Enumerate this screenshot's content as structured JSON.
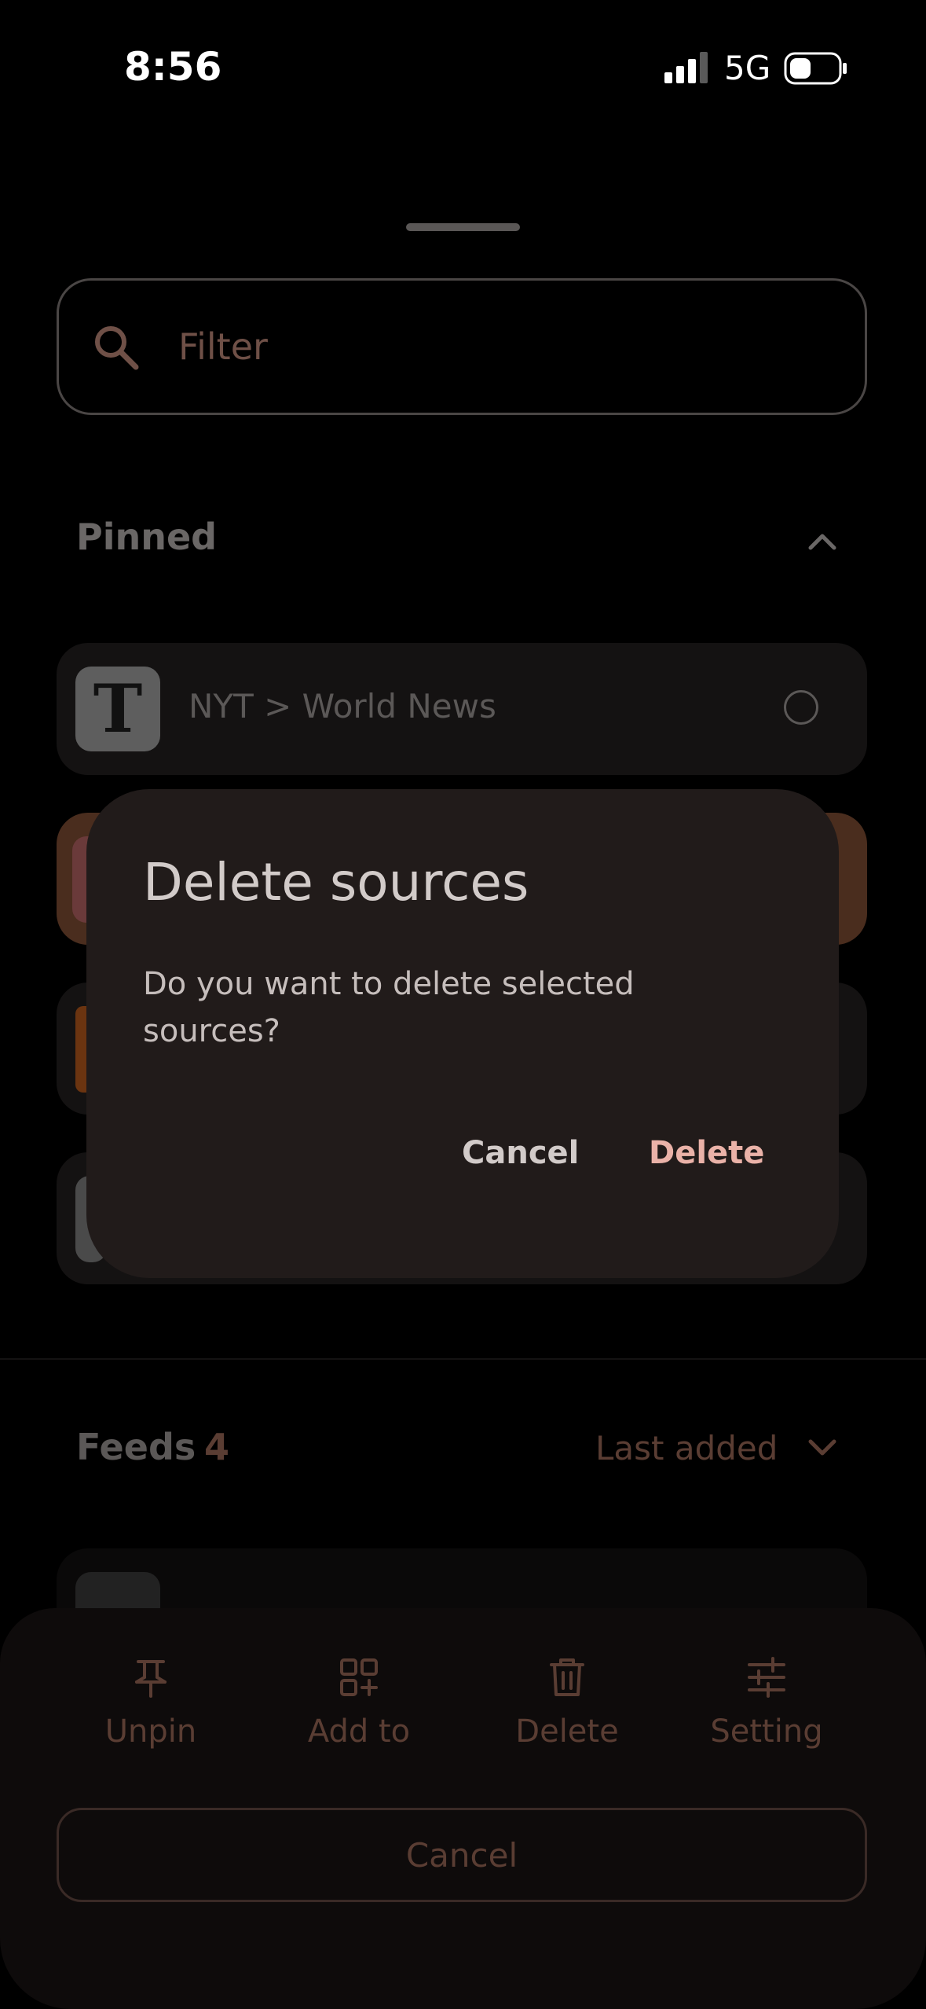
{
  "status_bar": {
    "time": "8:56",
    "network": "5G",
    "signal_icon": "cellular-signal-icon",
    "battery_icon": "battery-icon"
  },
  "filter": {
    "placeholder": "Filter",
    "icon": "search-icon"
  },
  "pinned": {
    "title": "Pinned",
    "items": [
      {
        "label": "NYT > World News",
        "logo": "T"
      }
    ]
  },
  "feeds": {
    "title": "Feeds",
    "count": "4",
    "sort_label": "Last added"
  },
  "dialog": {
    "title": "Delete sources",
    "message": "Do you want to delete selected sources?",
    "cancel_label": "Cancel",
    "delete_label": "Delete"
  },
  "bottom_actions": [
    {
      "label": "Unpin",
      "icon": "pin-icon"
    },
    {
      "label": "Add to",
      "icon": "add-to-group-icon"
    },
    {
      "label": "Delete",
      "icon": "trash-icon"
    },
    {
      "label": "Setting",
      "icon": "sliders-icon"
    }
  ],
  "bottom_cancel_label": "Cancel",
  "colors": {
    "dialog_bg": "#211b1a",
    "delete_accent": "#eab2a8",
    "muted_accent": "#5a3d33"
  }
}
